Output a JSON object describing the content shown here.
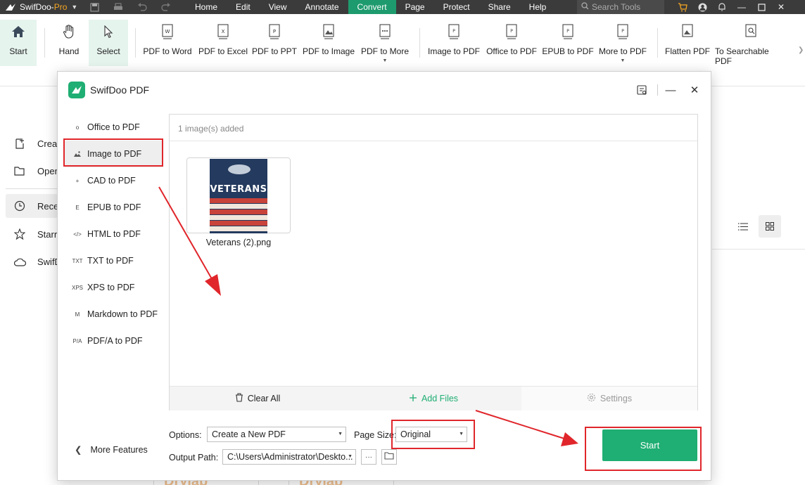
{
  "app": {
    "name": "SwifDoo-",
    "name_suffix": "Pro",
    "menu": [
      "Home",
      "Edit",
      "View",
      "Annotate",
      "Convert",
      "Page",
      "Protect",
      "Share",
      "Help"
    ],
    "active_menu": "Convert",
    "search_placeholder": "Search Tools"
  },
  "ribbon": {
    "start": "Start",
    "hand": "Hand",
    "select": "Select",
    "pdf_to_word": "PDF to Word",
    "pdf_to_excel": "PDF to Excel",
    "pdf_to_ppt": "PDF to PPT",
    "pdf_to_image": "PDF to Image",
    "pdf_to_more": "PDF to More",
    "image_to_pdf": "Image to PDF",
    "office_to_pdf": "Office to PDF",
    "epub_to_pdf": "EPUB to PDF",
    "more_to_pdf": "More to PDF",
    "flatten_pdf": "Flatten PDF",
    "to_searchable_pdf": "To Searchable PDF"
  },
  "background": {
    "items": [
      "Creat",
      "Open",
      "Recen",
      "Starre",
      "SwifD"
    ],
    "bottom_text": "Drylab"
  },
  "dialog": {
    "title": "SwifDoo PDF",
    "sidebar": [
      {
        "icon": "o",
        "label": "Office to PDF"
      },
      {
        "icon": "img",
        "label": "Image to PDF"
      },
      {
        "icon": "+",
        "label": "CAD to PDF"
      },
      {
        "icon": "E",
        "label": "EPUB to PDF"
      },
      {
        "icon": "</>",
        "label": "HTML to PDF"
      },
      {
        "icon": "TXT",
        "label": "TXT to PDF"
      },
      {
        "icon": "XPS",
        "label": "XPS to PDF"
      },
      {
        "icon": "M",
        "label": "Markdown to PDF"
      },
      {
        "icon": "P/A",
        "label": "PDF/A to PDF"
      }
    ],
    "active_sidebar": "Image to PDF",
    "more_features": "More Features",
    "count_text": "1 image(s) added",
    "file": {
      "name": "Veterans (2).png",
      "poster_title": "VETERANS"
    },
    "footer": {
      "clear_all": "Clear All",
      "add_files": "Add Files",
      "settings": "Settings"
    },
    "options_label": "Options:",
    "options_value": "Create a New PDF",
    "page_size_label": "Page Size:",
    "page_size_value": "Original",
    "output_label": "Output Path:",
    "output_value": "C:\\Users\\Administrator\\Deskto...",
    "more_btn": "···",
    "start": "Start"
  },
  "colors": {
    "accent": "#1fae73",
    "titlebar": "#3b3b3b",
    "annotation": "#e0262b"
  }
}
